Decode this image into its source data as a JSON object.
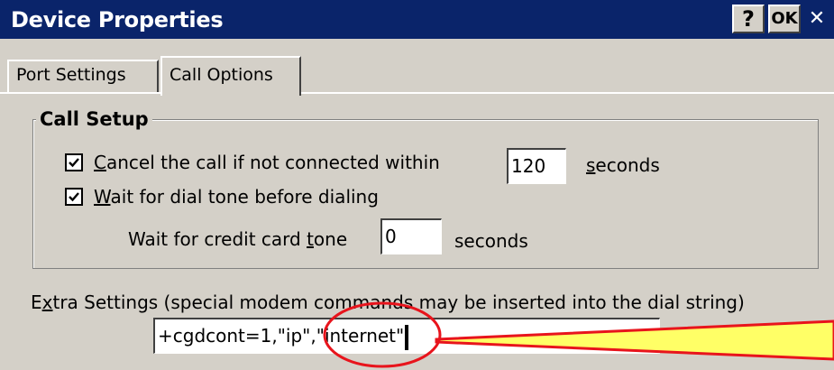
{
  "window": {
    "title": "Device Properties",
    "help_label": "?",
    "ok_label": "OK",
    "close_label": "✕"
  },
  "tabs": [
    {
      "label": "Port Settings",
      "selected": false
    },
    {
      "label": "Call Options",
      "selected": true
    }
  ],
  "call_setup": {
    "title": "Call Setup",
    "cancel_call": {
      "checked": true,
      "label_accel": "C",
      "label_rest": "ancel the call if not connected within",
      "value": "120",
      "unit_accel": "s",
      "unit_rest": "econds"
    },
    "wait_dial_tone": {
      "checked": true,
      "label_accel": "W",
      "label_rest": "ait for dial tone before dialing"
    },
    "credit_card": {
      "label_before": "Wait for credit card ",
      "label_accel": "t",
      "label_after": "one",
      "value": "0",
      "unit": "seconds"
    }
  },
  "extra_settings": {
    "label_before": "E",
    "label_accel": "x",
    "label_after": "tra Settings (special modem commands may be inserted into the dial string)",
    "value": "+cgdcont=1,\"ip\",\"internet\""
  },
  "annotation": {
    "ellipse_color": "#e8141c",
    "callout_fill": "#ffff66",
    "callout_stroke": "#e8141c"
  }
}
